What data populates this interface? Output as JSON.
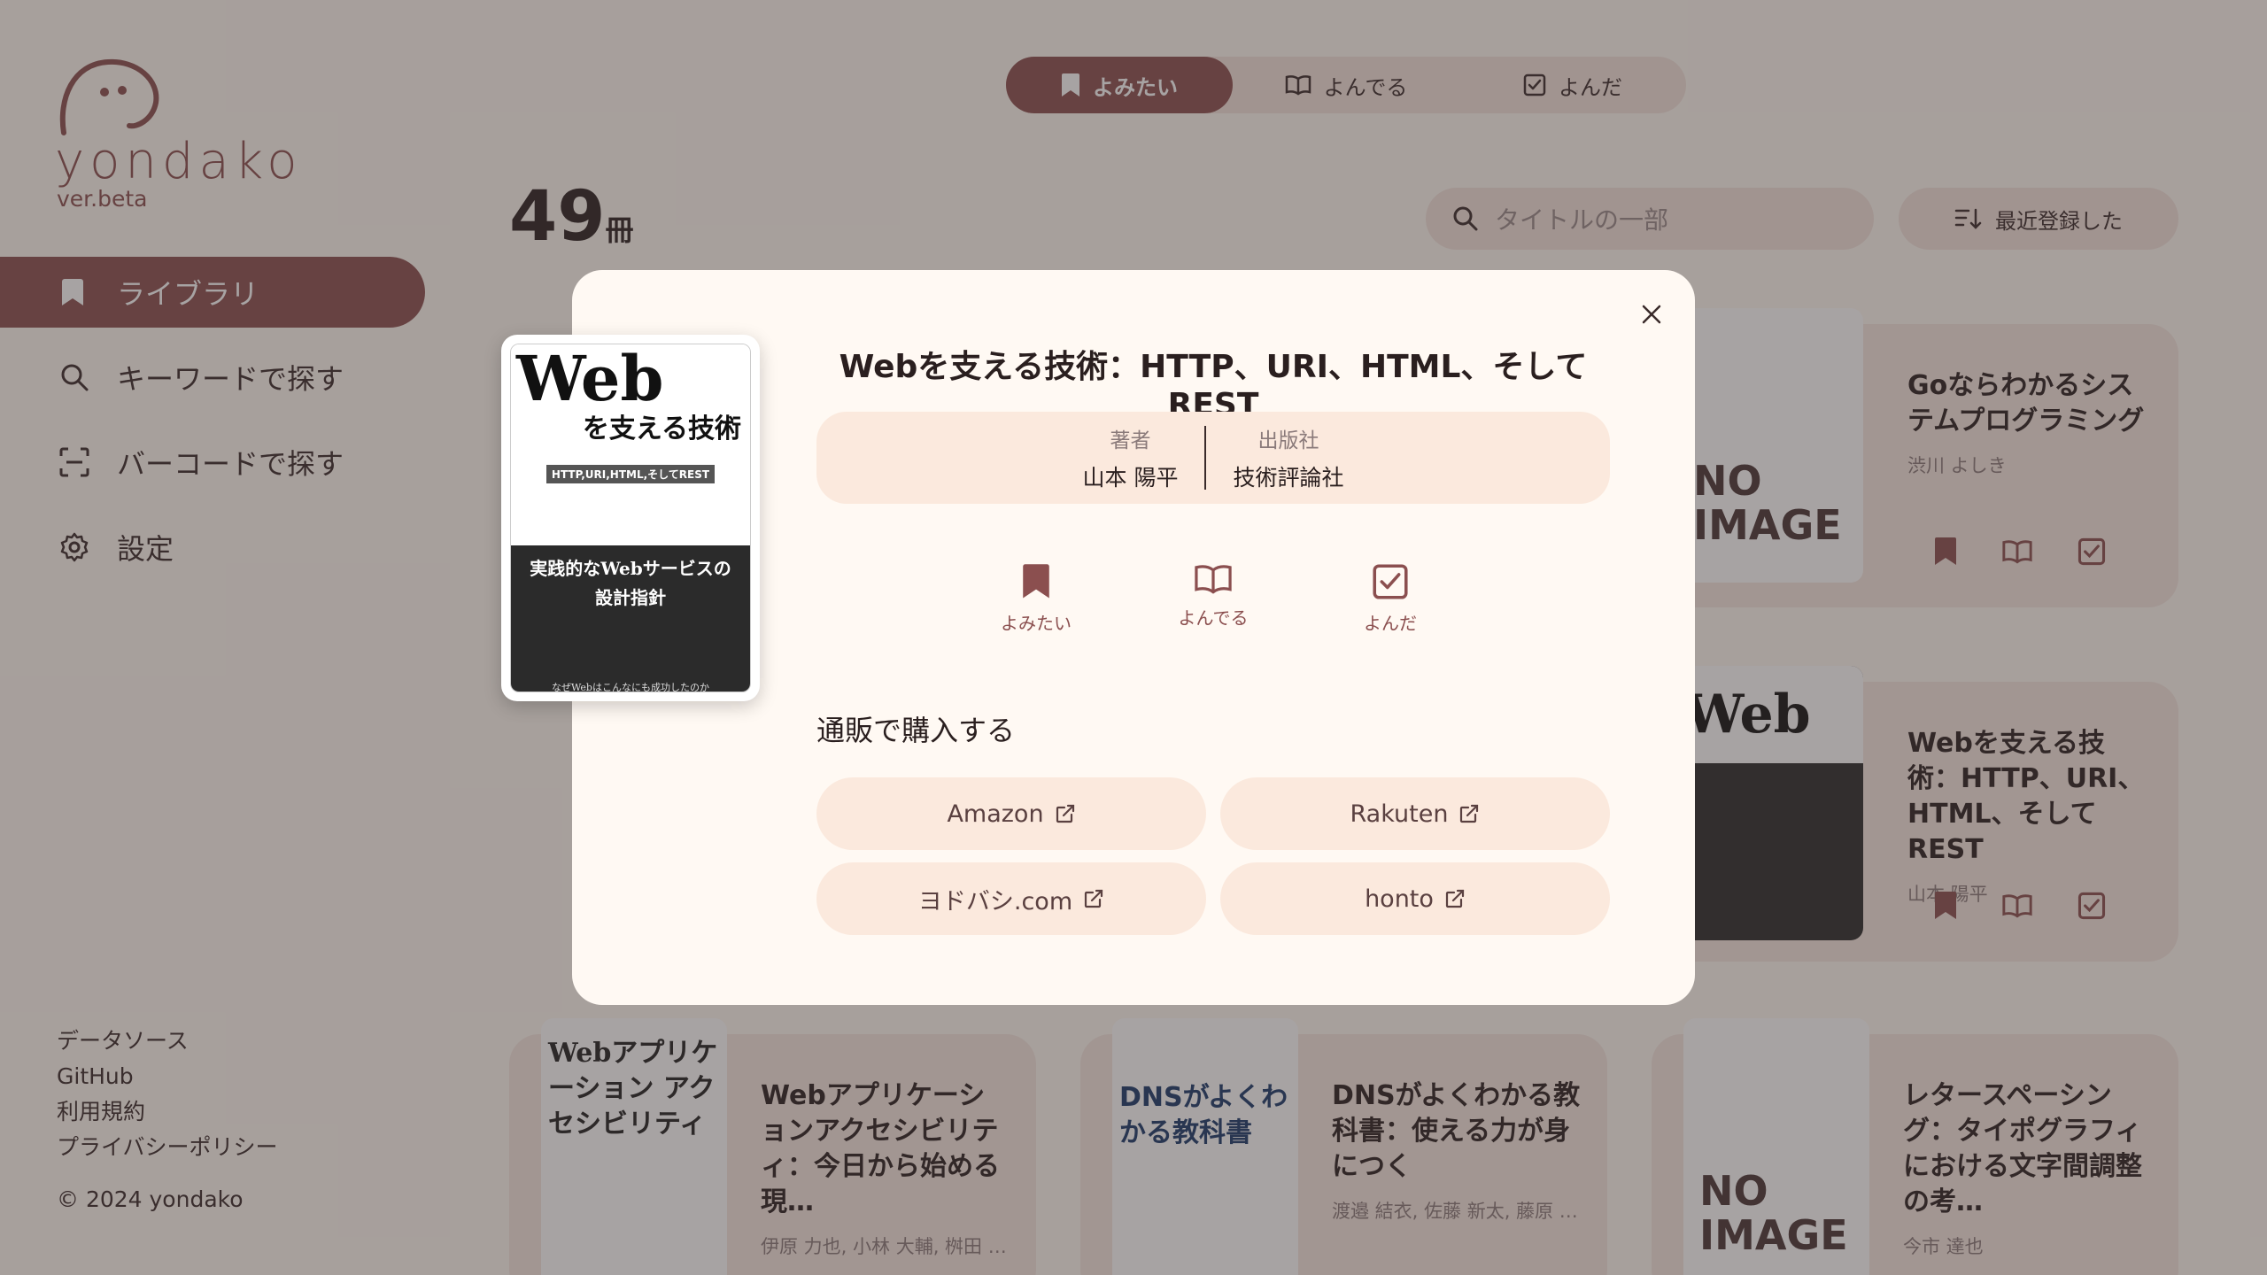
{
  "sidebar": {
    "logo_text": "yondako",
    "version": "ver.beta",
    "nav": [
      {
        "label": "ライブラリ",
        "icon": "bookmark-icon"
      },
      {
        "label": "キーワードで探す",
        "icon": "search-icon"
      },
      {
        "label": "バーコードで探す",
        "icon": "barcode-scan-icon"
      },
      {
        "label": "設定",
        "icon": "gear-icon"
      }
    ],
    "footer_links": [
      "データソース",
      "GitHub",
      "利用規約",
      "プライバシーポリシー"
    ],
    "copyright": "© 2024 yondako"
  },
  "tabs": [
    {
      "label": "よみたい",
      "active": true
    },
    {
      "label": "よんでる",
      "active": false
    },
    {
      "label": "よんだ",
      "active": false
    }
  ],
  "library": {
    "count": "49",
    "count_unit": "冊",
    "search_placeholder": "タイトルの一部",
    "sort_label": "最近登録した"
  },
  "cards": [
    {
      "title": "Goならわかるシステムプログラミング",
      "author": "渋川 よしき",
      "cover": "NO IMAGE"
    },
    {
      "title": "Webを支える技術：HTTP、URI、HTML、そしてREST",
      "author": "山本 陽平",
      "cover": "Web"
    },
    {
      "title": "Webアプリケーションアクセシビリティ：今日から始める現…",
      "author": "伊原 力也, 小林 大輔, 桝田 …",
      "cover": "Webアプリケーション アクセシビリティ"
    },
    {
      "title": "DNSがよくわかる教科書：使える力が身につく",
      "author": "渡邉 結衣, 佐藤 新太, 藤原 …",
      "cover": "DNSがよくわかる教科書"
    },
    {
      "title": "レタースペーシング：タイポグラフィにおける文字間調整の考…",
      "author": "今市 達也",
      "cover": "NO IMAGE"
    }
  ],
  "modal": {
    "title": "Webを支える技術：HTTP、URI、HTML、そしてREST",
    "author_label": "著者",
    "author": "山本 陽平",
    "publisher_label": "出版社",
    "publisher": "技術評論社",
    "status": [
      {
        "label": "よみたい",
        "icon": "bookmark-icon"
      },
      {
        "label": "よんでる",
        "icon": "open-book-icon"
      },
      {
        "label": "よんだ",
        "icon": "checkbox-icon"
      }
    ],
    "buy_title": "通販で購入する",
    "stores": [
      "Amazon",
      "Rakuten",
      "ヨドバシ.com",
      "honto"
    ],
    "cover": {
      "top": "Web",
      "sub": "を支える技術",
      "band": "HTTP,URI,HTML,そしてREST",
      "lower1": "実践的なWebサービスの",
      "lower2": "設計指針",
      "foot": "なぜWebはこんなにも成功したのか"
    }
  },
  "colors": {
    "accent": "#8b4f4f",
    "background": "#fff9f3",
    "chip": "#fbe9dd"
  }
}
